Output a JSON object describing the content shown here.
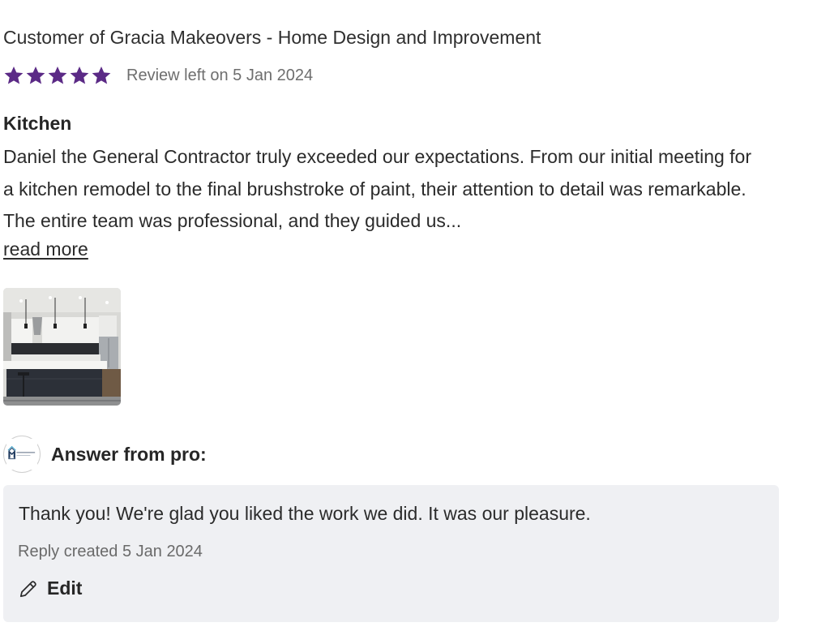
{
  "review": {
    "reviewer": "Customer of Gracia Makeovers - Home Design and Improvement",
    "rating": 5,
    "rating_max": 5,
    "star_color": "#5b2a86",
    "date_text": "Review left on 5 Jan 2024",
    "title": "Kitchen",
    "body": "Daniel the General Contractor truly exceeded our expectations. From our initial meeting for a kitchen remodel to the final brushstroke of paint, their attention to detail was remarkable. The entire team was professional, and they guided us...",
    "read_more": "read more",
    "photo_icon": "kitchen-photo"
  },
  "answer": {
    "label": "Answer from pro:",
    "avatar_icon": "company-logo",
    "reply_text": "Thank you! We're glad you liked the work we did. It was our pleasure.",
    "reply_date": "Reply created 5 Jan 2024",
    "edit_label": "Edit",
    "edit_icon": "pencil-icon"
  }
}
